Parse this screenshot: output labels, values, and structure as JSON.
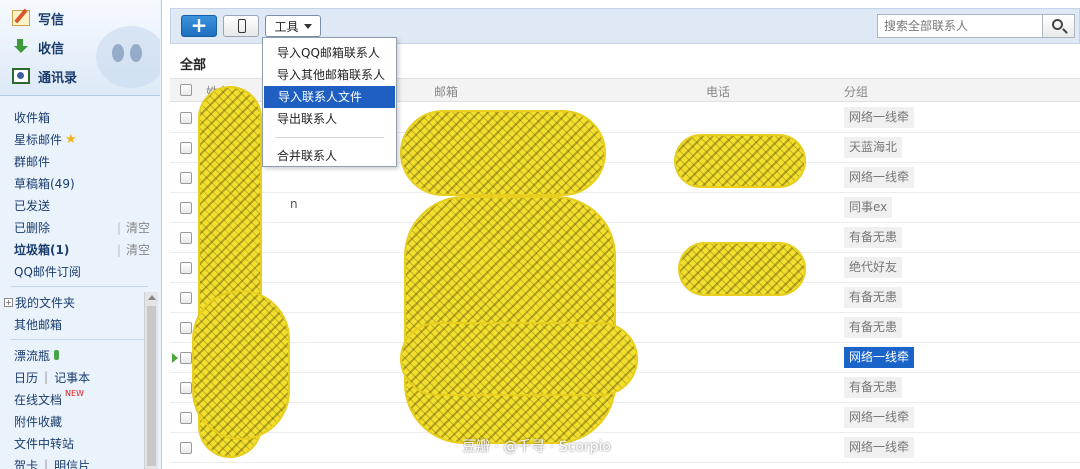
{
  "sidebar": {
    "top": {
      "write": "写信",
      "receive": "收信",
      "contacts": "通讯录"
    },
    "folders": [
      {
        "label": "收件箱"
      },
      {
        "label": "星标邮件"
      },
      {
        "label": "群邮件"
      },
      {
        "label": "草稿箱(49)"
      },
      {
        "label": "已发送"
      },
      {
        "label": "已删除",
        "clear": "清空"
      },
      {
        "label": "垃圾箱(1)",
        "clear": "清空"
      },
      {
        "label": "QQ邮件订阅"
      },
      {
        "label": "我的文件夹"
      },
      {
        "label": "其他邮箱"
      },
      {
        "label": "漂流瓶"
      },
      {
        "label": "日历"
      },
      {
        "label": "记事本"
      },
      {
        "label": "在线文档",
        "badge": "NEW"
      },
      {
        "label": "附件收藏"
      },
      {
        "label": "文件中转站"
      },
      {
        "label": "贺卡"
      },
      {
        "label": "明信片"
      }
    ]
  },
  "toolbar": {
    "add_label": "+",
    "tools_label": "工具",
    "search_placeholder": "搜索全部联系人"
  },
  "tools_menu": {
    "items": [
      "导入QQ邮箱联系人",
      "导入其他邮箱联系人",
      "导入联系人文件",
      "导出联系人",
      "合并联系人"
    ],
    "active_index": 2
  },
  "group_title": "全部",
  "table": {
    "headers": {
      "name": "姓名",
      "email": "邮箱",
      "phone": "电话",
      "group": "分组"
    },
    "rows": [
      {
        "group": "网络一线牵"
      },
      {
        "group": "天蓝海北"
      },
      {
        "group": "网络一线牵"
      },
      {
        "group": "同事ex"
      },
      {
        "group": "有备无患"
      },
      {
        "group": "绝代好友"
      },
      {
        "group": "有备无患"
      },
      {
        "group": "有备无患"
      },
      {
        "group": "网络一线牵",
        "selected": true
      },
      {
        "group": "有备无患"
      },
      {
        "group": "网络一线牵"
      },
      {
        "group": "网络一线牵"
      }
    ],
    "row4_tail": "n"
  },
  "watermark": "豆瓣 · @千寻 · Scorpio",
  "colors": {
    "accent": "#1f6fc0",
    "redaction": "#f3df2d",
    "selected_tag": "#1a63c9"
  }
}
